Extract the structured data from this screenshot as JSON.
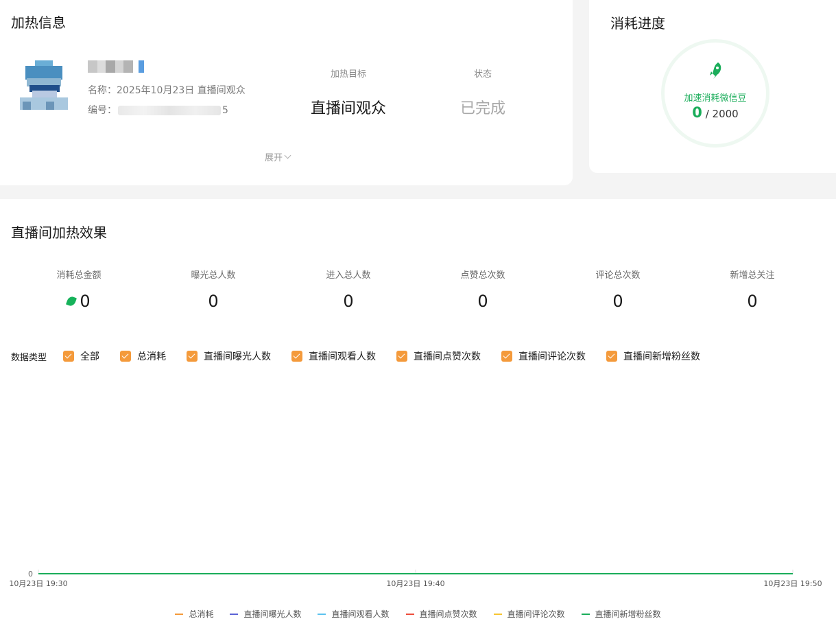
{
  "info": {
    "title": "加热信息",
    "name_label": "名称：",
    "name_value": "2025年10月23日 直播间观众",
    "id_label": "编号：",
    "id_suffix": "5",
    "target_label": "加热目标",
    "target_value": "直播间观众",
    "status_label": "状态",
    "status_value": "已完成",
    "expand_label": "展开"
  },
  "progress": {
    "title": "消耗进度",
    "label": "加速消耗微信豆",
    "current": "0",
    "total": "/ 2000",
    "fraction": 0
  },
  "effect": {
    "title": "直播间加热效果",
    "stats": [
      {
        "label": "消耗总金额",
        "value": "0"
      },
      {
        "label": "曝光总人数",
        "value": "0"
      },
      {
        "label": "进入总人数",
        "value": "0"
      },
      {
        "label": "点赞总次数",
        "value": "0"
      },
      {
        "label": "评论总次数",
        "value": "0"
      },
      {
        "label": "新增总关注",
        "value": "0"
      }
    ],
    "filter_title": "数据类型",
    "filters": [
      "全部",
      "总消耗",
      "直播间曝光人数",
      "直播间观看人数",
      "直播间点赞次数",
      "直播间评论次数",
      "直播间新增粉丝数"
    ]
  },
  "colors": {
    "accent_green": "#1aad5a",
    "checkbox_orange": "#f49a3b"
  },
  "chart_data": {
    "type": "line",
    "x": [
      "10月23日 19:30",
      "10月23日 19:40",
      "10月23日 19:50"
    ],
    "y_ticks": [
      "0"
    ],
    "series": [
      {
        "name": "总消耗",
        "color": "#f49a3b",
        "values": [
          0,
          0,
          0
        ]
      },
      {
        "name": "直播间曝光人数",
        "color": "#5b63d6",
        "values": [
          0,
          0,
          0
        ]
      },
      {
        "name": "直播间观看人数",
        "color": "#5bc2ef",
        "values": [
          0,
          0,
          0
        ]
      },
      {
        "name": "直播间点赞次数",
        "color": "#ee4d3c",
        "values": [
          0,
          0,
          0
        ]
      },
      {
        "name": "直播间评论次数",
        "color": "#f7c531",
        "values": [
          0,
          0,
          0
        ]
      },
      {
        "name": "直播间新增粉丝数",
        "color": "#1aad5a",
        "values": [
          0,
          0,
          0
        ]
      }
    ],
    "legend": "bottom"
  }
}
